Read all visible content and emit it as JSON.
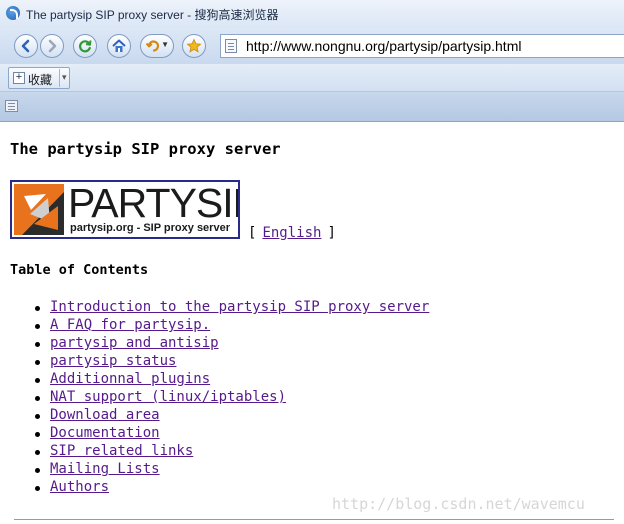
{
  "window": {
    "title": "The partysip SIP proxy server - 搜狗高速浏览器"
  },
  "toolbar": {
    "address": "http://www.nongnu.org/partysip/partysip.html",
    "icons": [
      "back-icon",
      "forward-icon",
      "refresh-icon",
      "home-icon",
      "undo-icon",
      "favorite-star-icon"
    ]
  },
  "favorites_bar": {
    "label": "收藏",
    "plus": "+",
    "caret": "▾"
  },
  "page": {
    "heading": "The partysip SIP proxy server",
    "logo": {
      "wordmark": "PARTYSIP",
      "tagline": "partysip.org - SIP proxy server",
      "accent_color": "#e8731c",
      "border_color": "#2a2a8a"
    },
    "language": {
      "open_bracket": "[",
      "link": "English",
      "close_bracket": "]"
    },
    "toc_title": "Table of Contents",
    "toc": [
      "Introduction to the partysip SIP proxy server",
      "A FAQ for partysip.",
      "partysip and antisip",
      "partysip status",
      "Additionnal plugins",
      "NAT support (linux/iptables)",
      "Download area",
      "Documentation",
      "SIP related links",
      "Mailing Lists",
      "Authors"
    ],
    "link_color": "#551a8b"
  },
  "watermark": "http://blog.csdn.net/wavemcu"
}
